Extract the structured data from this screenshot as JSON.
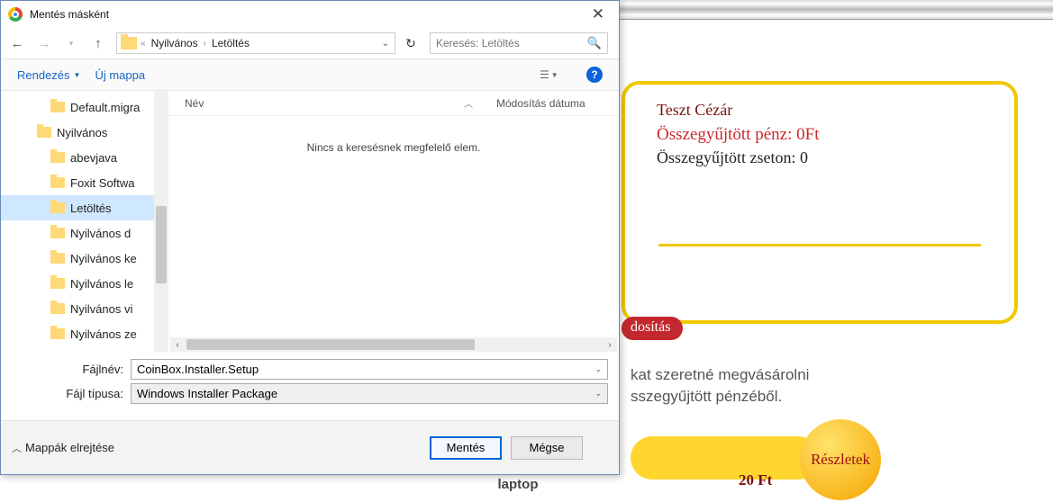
{
  "bg": {
    "user_name": "Teszt Cézár",
    "money": "Összegyűjtött pénz: 0Ft",
    "chips": "Összegyűjtött zseton: 0",
    "mod_badge": "dosítás",
    "hint1": "kat szeretné megvásárolni",
    "hint2": "sszegyűjtött pénzéből.",
    "item_name": "laptop",
    "item_price": "20 Ft",
    "details": "Részletek"
  },
  "dialog": {
    "title": "Mentés másként",
    "crumb1": "Nyilvános",
    "crumb2": "Letöltés",
    "search_placeholder": "Keresés: Letöltés",
    "organize": "Rendezés",
    "new_folder": "Új mappa",
    "col_name": "Név",
    "col_mod": "Módosítás dátuma",
    "empty_msg": "Nincs a keresésnek megfelelő elem.",
    "filename_label": "Fájlnév:",
    "filetype_label": "Fájl típusa:",
    "filename_value": "CoinBox.Installer.Setup",
    "filetype_value": "Windows Installer Package",
    "hide_folders": "Mappák elrejtése",
    "save": "Mentés",
    "cancel": "Mégse",
    "tree": {
      "i0": "Default.migra",
      "i1": "Nyilvános",
      "i2": "abevjava",
      "i3": "Foxit Softwa",
      "i4": "Letöltés",
      "i5": "Nyilvános d",
      "i6": "Nyilvános ke",
      "i7": "Nyilvános le",
      "i8": "Nyilvános vi",
      "i9": "Nyilvános ze"
    }
  }
}
